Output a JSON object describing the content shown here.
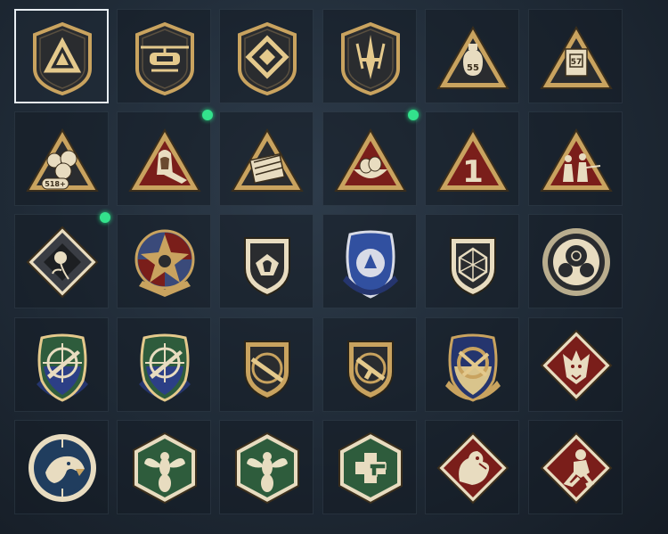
{
  "emblems": [
    {
      "icon": "triangle-a-emblem-icon",
      "selected": true,
      "new": false
    },
    {
      "icon": "helicopter-emblem-icon",
      "selected": false,
      "new": false
    },
    {
      "icon": "diamond-chevrons-emblem-icon",
      "selected": false,
      "new": false
    },
    {
      "icon": "knife-emblem-icon",
      "selected": false,
      "new": false
    },
    {
      "icon": "moneybag-55-emblem-icon",
      "selected": false,
      "new": false,
      "badge_text": "55"
    },
    {
      "icon": "container-57-emblem-icon",
      "selected": false,
      "new": false,
      "badge_text": "57"
    },
    {
      "icon": "cash-pile-518-emblem-icon",
      "selected": false,
      "new": false,
      "badge_text": "518+"
    },
    {
      "icon": "hooded-operator-emblem-icon",
      "selected": false,
      "new": true
    },
    {
      "icon": "supply-crate-emblem-icon",
      "selected": false,
      "new": false
    },
    {
      "icon": "nest-eggs-emblem-icon",
      "selected": false,
      "new": true
    },
    {
      "icon": "first-place-emblem-icon",
      "selected": false,
      "new": false,
      "badge_text": "1"
    },
    {
      "icon": "squad-silhouette-emblem-icon",
      "selected": false,
      "new": false
    },
    {
      "icon": "rose-emblem-icon",
      "selected": false,
      "new": true
    },
    {
      "icon": "star-skull-emblem-icon",
      "selected": false,
      "new": false
    },
    {
      "icon": "flame-shield-emblem-icon",
      "selected": false,
      "new": false
    },
    {
      "icon": "blue-winged-badge-emblem-icon",
      "selected": false,
      "new": false
    },
    {
      "icon": "d20-dice-emblem-icon",
      "selected": false,
      "new": false
    },
    {
      "icon": "crosshair-skull-emblem-icon",
      "selected": false,
      "new": false
    },
    {
      "icon": "rifle-crosshair-green-shield-icon",
      "selected": false,
      "new": false
    },
    {
      "icon": "rifle-crosshair-green-shield-alt-icon",
      "selected": false,
      "new": false
    },
    {
      "icon": "shotgun-circle-emblem-icon",
      "selected": false,
      "new": false
    },
    {
      "icon": "smg-circle-emblem-icon",
      "selected": false,
      "new": false
    },
    {
      "icon": "gold-rifles-shield-emblem-icon",
      "selected": false,
      "new": false
    },
    {
      "icon": "wolf-diamond-emblem-icon",
      "selected": false,
      "new": false
    },
    {
      "icon": "eagle-circle-emblem-icon",
      "selected": false,
      "new": false
    },
    {
      "icon": "wasp-hexagon-emblem-icon",
      "selected": false,
      "new": false
    },
    {
      "icon": "wasp-hexagon-alt-emblem-icon",
      "selected": false,
      "new": false
    },
    {
      "icon": "medic-pistol-hexagon-emblem-icon",
      "selected": false,
      "new": false
    },
    {
      "icon": "dragon-diamond-emblem-icon",
      "selected": false,
      "new": false
    },
    {
      "icon": "runner-diamond-emblem-icon",
      "selected": false,
      "new": false
    }
  ],
  "palette": {
    "gold": "#c9a35f",
    "gold_light": "#e4c98c",
    "dark": "#2a2c2f",
    "maroon": "#7a1e1a",
    "green": "#2e5c3c",
    "navy": "#25356e",
    "blue": "#3150a0",
    "cream": "#e8dcc0"
  }
}
